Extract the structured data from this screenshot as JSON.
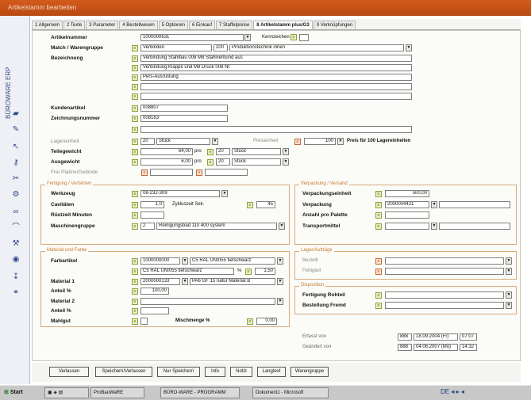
{
  "window": {
    "title": "Artikelstamm bearbeiten"
  },
  "sidebar": {
    "vertical_text": "BÜROWARE ERP"
  },
  "tabs": [
    "1 Allgemein",
    "2 Texte",
    "3 Parameter",
    "4 Bestellwesen",
    "5 Optionen",
    "6 Einkauf",
    "7 Staffelpreise",
    "8 Artikelstamm plus/G3",
    "9 Verknüpfungen"
  ],
  "artikel": {
    "artikelnummer_label": "Artikelnummer",
    "artikelnummer": "1000000631",
    "kennzeichen_label": "Kennzeichen",
    "match_label": "Match / Warengruppe",
    "match": "Verbinden",
    "wg_nr": "200",
    "wg_name": "Produktionstechnik innen",
    "bezeichnung_label": "Bezeichnung",
    "bez1": "Verbindung Stahlbau 008 M8 Stahlverbund aus",
    "bez2": "Verbindung Klappe und M8 Druck 008 Nt",
    "bez3": "Pers-Ausrüstung",
    "bez4": "",
    "bez5": "",
    "kunden_label": "Kundenartikel",
    "kunden": "008807",
    "zeich_label": "Zeichnungsnummer",
    "zeich": "008163",
    "lager_label": "Lagereinheit",
    "lager_unit": "20",
    "lager_name": "Stück",
    "preis_label": "Preiseinheit",
    "preis": "100",
    "preis_text": "Preis für 100 Lagereinheiten",
    "teil_label": "Teilegewicht",
    "teil": "64,00",
    "teil_pro": "pro",
    "teil_unit": "20",
    "teil_name": "Stück",
    "ausg_label": "Ausgewicht",
    "ausg": "6,00",
    "ausg_pro": "pro",
    "ausg_unit": "20",
    "ausg_name": "Stück",
    "freip_label": "Frei Platine/Gebinde"
  },
  "fertigung": {
    "title": "Fertigung / Verfahren",
    "werkzeug_label": "Werkzeug",
    "werkzeug": "08-232-309",
    "cavitaeten_label": "Cavitäten",
    "cavitaeten": "1,0",
    "zyk_label": "Zykluszeit Sek.",
    "zyk": "45",
    "rostzeit_label": "Rüstzeit Minuten",
    "rostzeit": "",
    "maschgr_label": "Maschinengruppe",
    "maschgr": "2",
    "maschgr_name": "Reinigungsbad 110 400 system"
  },
  "verpackung": {
    "title": "Verpackung / Versand",
    "einheit_label": "Verpackungseinheit",
    "einheit": "500,00",
    "verp_label": "Verpackung",
    "verp": "2000004421",
    "anzahl_label": "Anzahl pro Palette",
    "anzahl": "",
    "transport_label": "Transportmittel",
    "transport": ""
  },
  "material": {
    "title": "Material und Farbe",
    "farbe_label": "Farbartikel",
    "farbe": "1000000000",
    "farbe_name": "C5 RAL UNI055 tiefschwarz",
    "farbe2": "C5 RAL UNI055 tiefschwarz",
    "farbe_pct_label": "%",
    "farbe_pct": "1,50",
    "mat1_label": "Material 1",
    "mat1": "2000000133",
    "mat1_name": "PA6 GF 15 natur Material B",
    "anteil1_label": "Anteil %",
    "anteil1": "100,00",
    "mat2_label": "Material 2",
    "mat2": "",
    "anteil2_label": "Anteil %",
    "anteil2": "",
    "mahlgut_label": "Mahlgut",
    "mahlmenge_label": "Mischmenge %",
    "mahlmenge": "0,00"
  },
  "lager": {
    "title": "Lager/Aufträge",
    "bestellt_label": "Bestellt",
    "bestellt": "",
    "fertig_label": "Fertigteil",
    "fertig": ""
  },
  "dispo": {
    "title": "Disposition",
    "fert_label": "Fertigung Rohteil",
    "fert": "",
    "best_label": "Bestellung Fremd",
    "best": ""
  },
  "audit": {
    "erfasst_label": "Erfasst von",
    "erfasst_user": "888",
    "erfasst_date": "18.09.2004 (Fr)",
    "erfasst_time": "07:07",
    "geaendert_label": "Geändert von",
    "geaendert_user": "888",
    "geaendert_date": "04.06.2007 (Mo)",
    "geaendert_time": "14:32"
  },
  "buttons": [
    "Verlassen",
    "Speichern/Verlassen",
    "Nur Speichern",
    "Info",
    "Notiz",
    "Langtext",
    "Warengruppe"
  ],
  "taskbar": {
    "start": "Start",
    "tasks": [
      "ProBauWaRE",
      "BÜRO-WARE - PROGRAMM",
      "Dokument1 - Microsoft"
    ],
    "tray": "DE ◂ ▸ ◂"
  },
  "colors": {
    "titlebar": "#c4521a",
    "group_border": "#d8a978",
    "icon_green": "#e6efc2",
    "icon_red": "#fbe0cc"
  }
}
